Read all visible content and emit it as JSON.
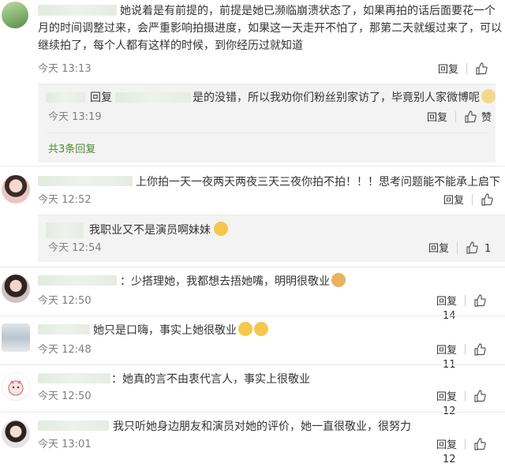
{
  "labels": {
    "reply": "回复",
    "like": "赞"
  },
  "comments": [
    {
      "text": "她说着是有前提的，前提是她已濒临崩溃状态了，如果再拍的话后面要花一个月的时间调整过来，会严重影响拍摄进度，如果这一天走开不怕了，那第二天就缓过来了，可以继续拍了，每个人都有这样的时候，到你经历过就知道",
      "time": "今天 13:13",
      "nested": {
        "prefix": "回复",
        "text": "是的没错，所以我劝你们粉丝别家访了，毕竟别人家微博呢",
        "time": "今天 13:19",
        "like_label": "赞"
      },
      "more": "共3条回复"
    },
    {
      "text": "上你拍一天一夜两天两夜三天三夜你拍不拍！！！思考问题能不能承上启下",
      "time": "今天 12:52",
      "nested": {
        "text": "我职业又不是演员啊妹妹",
        "time": "今天 12:54",
        "likes": "1"
      }
    },
    {
      "text": "：少搭理她，我都想去捂她嘴，明明很敬业",
      "time": "今天 12:50",
      "likes": "14"
    },
    {
      "text": "她只是口嗨，事实上她很敬业",
      "time": "今天 12:48",
      "likes": "11"
    },
    {
      "text": "：她真的言不由衷代言人，事实上很敬业",
      "time": "今天 12:50",
      "likes": "12"
    },
    {
      "text": "我只听她身边朋友和演员对她的评价，她一直很敬业，很努力",
      "time": "今天 13:01",
      "likes": "12"
    }
  ]
}
